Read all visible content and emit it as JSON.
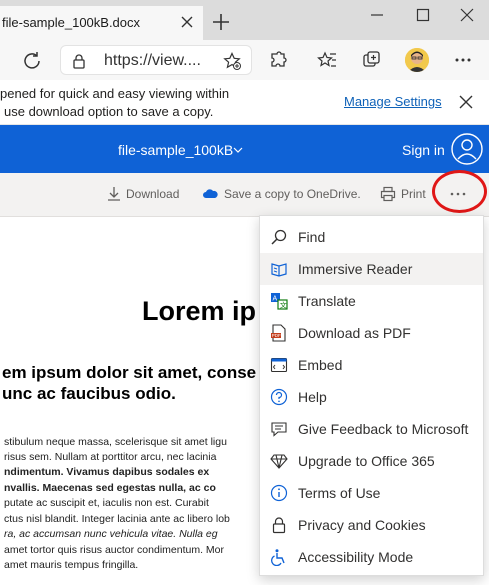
{
  "browser": {
    "tab_title": "file-sample_100kB.docx",
    "url": "https://view...."
  },
  "infobar": {
    "line1": "pened for quick and easy viewing within",
    "line2": "use download option to save a copy.",
    "manage_settings": "Manage Settings"
  },
  "office": {
    "doc_title": "file-sample_100kB",
    "sign_in": "Sign in"
  },
  "commands": {
    "download": "Download",
    "save_onedrive": "Save a copy to OneDrive.",
    "print": "Print"
  },
  "document": {
    "heading": "Lorem ip",
    "subheading_line1": "em ipsum dolor sit amet, conse",
    "subheading_line2": "unc ac faucibus odio.",
    "paragraph_lines": [
      "stibulum neque massa, scelerisque sit amet ligu",
      "risus sem. Nullam at porttitor arcu, nec lacinia",
      "ndimentum. Vivamus dapibus sodales ex",
      "nvallis. Maecenas sed egestas nulla, ac co",
      "putate ac suscipit et, iaculis non est. Curabit",
      "ctus nisl blandit. Integer lacinia ante ac libero lob",
      "ra, ac accumsan nunc vehicula vitae. Nulla eg",
      "amet tortor quis risus auctor condimentum. Mor",
      "amet mauris tempus fringilla."
    ]
  },
  "menu": {
    "items": [
      {
        "label": "Find",
        "icon": "search-icon"
      },
      {
        "label": "Immersive Reader",
        "icon": "immersive-reader-icon"
      },
      {
        "label": "Translate",
        "icon": "translate-icon"
      },
      {
        "label": "Download as PDF",
        "icon": "pdf-icon"
      },
      {
        "label": "Embed",
        "icon": "embed-icon"
      },
      {
        "label": "Help",
        "icon": "help-icon"
      },
      {
        "label": "Give Feedback to Microsoft",
        "icon": "feedback-icon"
      },
      {
        "label": "Upgrade to Office 365",
        "icon": "diamond-icon"
      },
      {
        "label": "Terms of Use",
        "icon": "info-icon"
      },
      {
        "label": "Privacy and Cookies",
        "icon": "lock-icon"
      },
      {
        "label": "Accessibility Mode",
        "icon": "accessibility-icon"
      }
    ]
  },
  "colors": {
    "office_blue": "#0f62d6",
    "link_blue": "#0f62b8",
    "highlight_red": "#e01717"
  }
}
